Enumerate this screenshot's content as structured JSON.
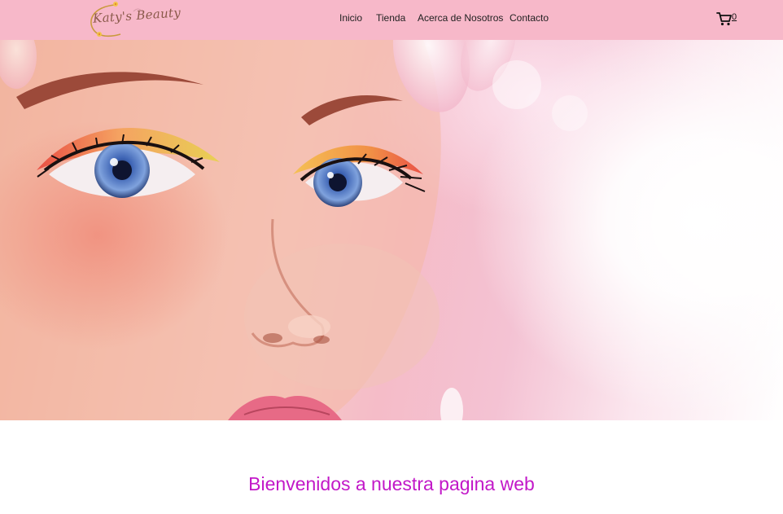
{
  "brand": {
    "logo_text": "Katy's Beauty",
    "logo_icon": "flower-circle-logo"
  },
  "nav": {
    "items": [
      {
        "label": "Inicio"
      },
      {
        "label": "Tienda"
      },
      {
        "label": "Acerca de Nosotros"
      },
      {
        "label": "Contacto"
      }
    ]
  },
  "cart": {
    "icon": "cart-icon",
    "count": "0"
  },
  "hero": {
    "image": "woman-face-closeup-colorful-eye-makeup"
  },
  "main": {
    "welcome_heading": "Bienvenidos a nuestra pagina web"
  },
  "colors": {
    "header_bg": "#f7b8c9",
    "heading": "#c218c8",
    "page_bg": "#ffffff"
  }
}
